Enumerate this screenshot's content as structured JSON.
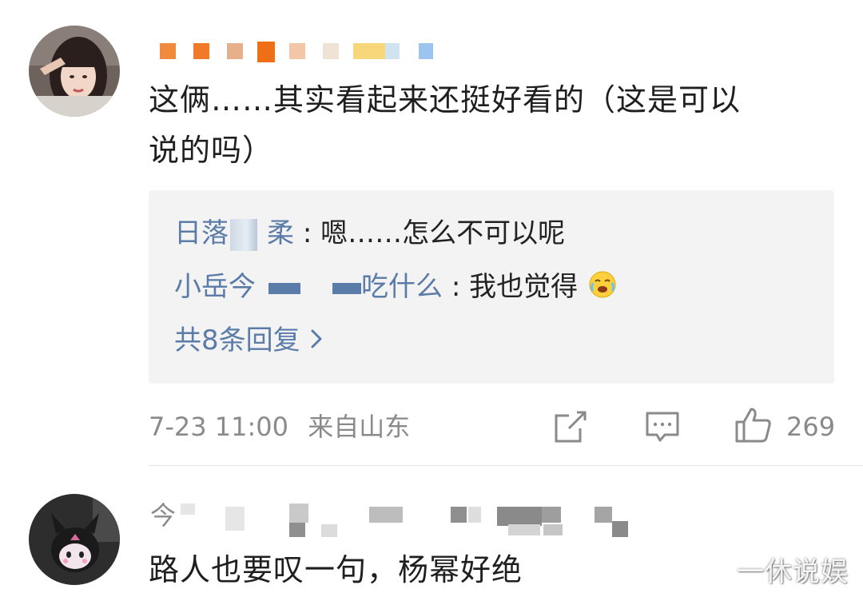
{
  "comments": [
    {
      "body_line1": "这俩……其实看起来还挺好看的（这是可以",
      "body_line2": "说的吗）",
      "replies": [
        {
          "user_visible_start": "日落",
          "user_visible_end": "柔",
          "text": ": 嗯……怎么不可以呢"
        },
        {
          "user_visible_start": "小岳今",
          "user_visible_end": "吃什么",
          "text": ": 我也觉得",
          "emoji": "crying-laughing-emoji"
        }
      ],
      "more_replies_label": "共8条回复",
      "timestamp": "7-23 11:00",
      "location": "来自山东",
      "like_count": "269"
    },
    {
      "username_visible_start": "今",
      "body": "路人也要叹一句，杨幂好绝"
    }
  ],
  "watermark": "一休说娱",
  "colors": {
    "link_blue": "#5b7ba8",
    "text_dark": "#1f1f1f",
    "text_meta": "#8a8a8a",
    "reply_bg": "#f3f3f3"
  },
  "icons": {
    "share": "share-icon",
    "reply": "comment-icon",
    "like": "thumbs-up-icon",
    "more": "chevron-right-icon"
  }
}
